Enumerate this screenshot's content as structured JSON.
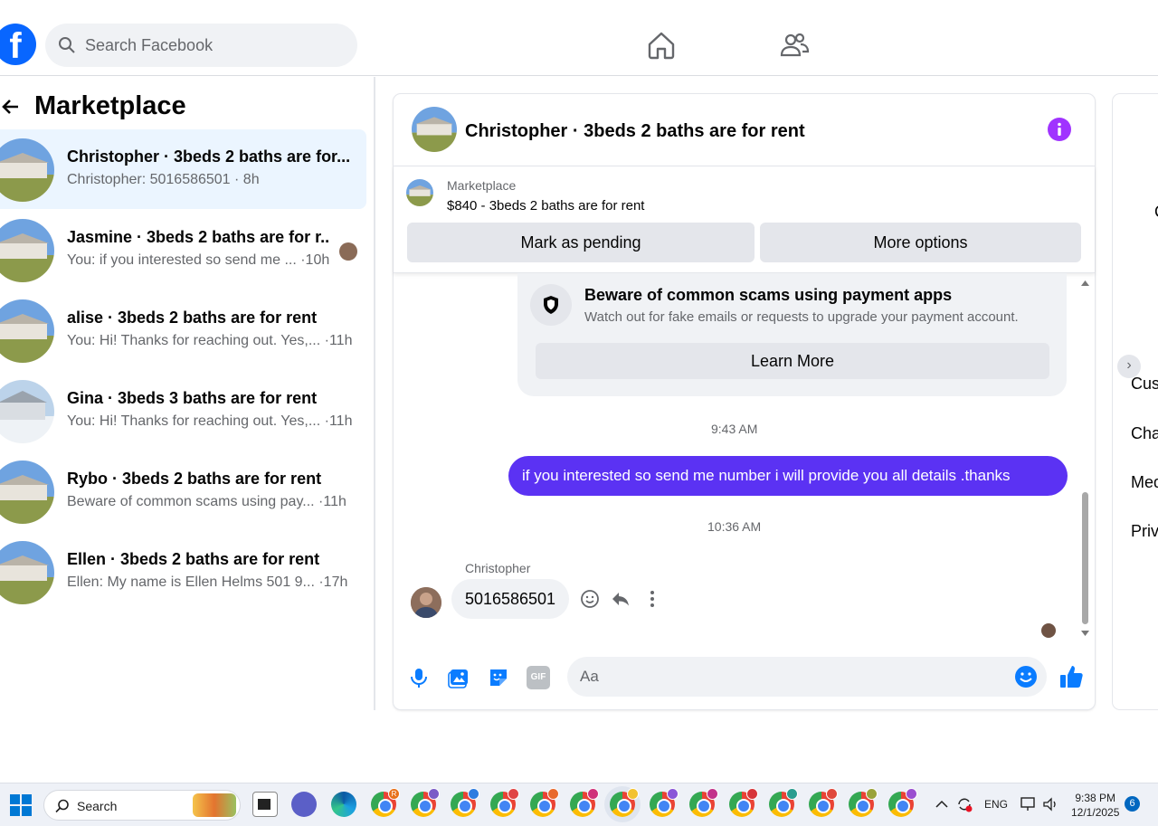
{
  "topbar": {
    "logo": "f",
    "search_placeholder": "Search Facebook"
  },
  "marketplace": {
    "title": "Marketplace",
    "conversations": [
      {
        "name": "Christopher · 3beds 2 baths are for...",
        "sub": "Christopher: 5016586501 · 8h"
      },
      {
        "name": "Jasmine · 3beds 2 baths are for r...",
        "sub": "You: if you interested so send me ... ·10h"
      },
      {
        "name": "alise · 3beds 2 baths are for rent",
        "sub": "You: Hi! Thanks for reaching out. Yes,... ·11h"
      },
      {
        "name": "Gina · 3beds 3 baths are for rent",
        "sub": "You: Hi! Thanks for reaching out. Yes,... ·11h"
      },
      {
        "name": "Rybo · 3beds 2 baths are for rent",
        "sub": "Beware of common scams using pay... ·11h"
      },
      {
        "name": "Ellen · 3beds 2 baths are for rent",
        "sub": "Ellen: My name is Ellen Helms 501 9... ·17h"
      }
    ]
  },
  "chat": {
    "title": "Christopher · 3beds 2 baths are for rent",
    "listing_label": "Marketplace",
    "listing_price": "$840 - 3beds 2 baths are for rent",
    "mark_pending": "Mark as pending",
    "more_options": "More options",
    "scam_title": "Beware of common scams using payment apps",
    "scam_sub": "Watch out for fake emails or requests to upgrade your payment account.",
    "learn_more": "Learn More",
    "time1": "9:43 AM",
    "outgoing": "if you interested so send me number i will provide you all details .thanks",
    "time2": "10:36 AM",
    "sender": "Christopher",
    "incoming": "5016586501",
    "composer_placeholder": "Aa",
    "gif_label": "GIF"
  },
  "right_panel": {
    "c": "C",
    "items": [
      "Cus",
      "Cha",
      "Med",
      "Priv"
    ]
  },
  "taskbar": {
    "search": "Search",
    "lang": "ENG",
    "time": "9:38 PM",
    "date": "12/1/2025",
    "notifications": "6",
    "profile_badges": [
      "R"
    ]
  },
  "colors": {
    "brand": "#0866ff",
    "messenger_purple": "#5b32f3",
    "info": "#a033ff",
    "composer_blue": "#0a7cff"
  }
}
